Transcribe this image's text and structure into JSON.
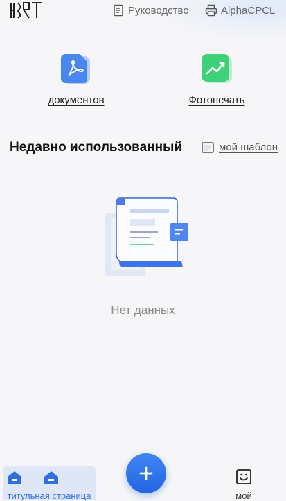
{
  "header": {
    "logo_text": "HPRT",
    "manual_label": "Руководство",
    "manual_icon": "document-icon",
    "printer_label": "AlphaCPCL",
    "printer_icon": "printer-icon"
  },
  "actions": [
    {
      "label": "документов",
      "icon": "pdf-icon",
      "color": "#4a86f0"
    },
    {
      "label": "Фотопечать",
      "icon": "photo-chart-icon",
      "color": "#3fd07a"
    }
  ],
  "recent": {
    "title": "Недавно использованный",
    "template_label": "мой шаблон",
    "template_icon": "template-icon",
    "empty_text": "Нет данных"
  },
  "tabbar": {
    "home_label": "титульная страница",
    "add_icon": "plus-icon",
    "mine_label": "мой",
    "active_color": "#2f6fe0"
  }
}
